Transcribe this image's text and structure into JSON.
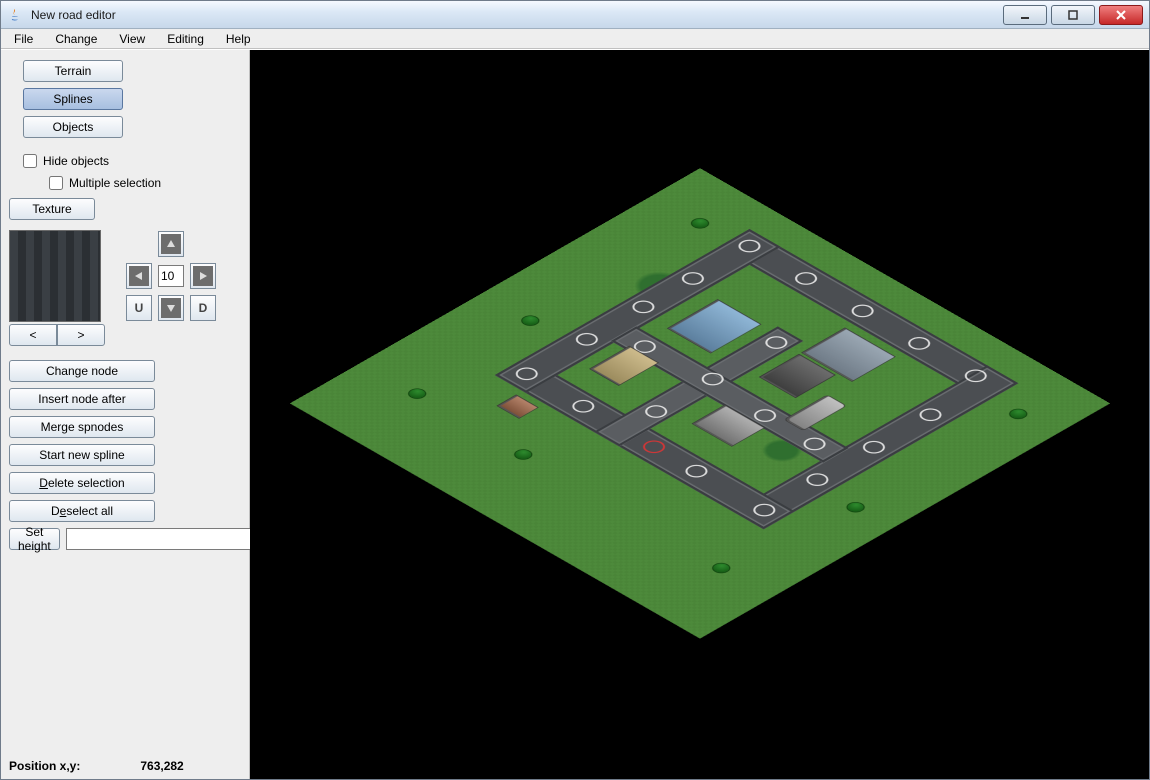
{
  "window": {
    "title": "New road editor"
  },
  "menu": {
    "file": "File",
    "change": "Change",
    "view": "View",
    "editing": "Editing",
    "help": "Help"
  },
  "sidebar": {
    "mode_buttons": {
      "terrain": "Terrain",
      "splines": "Splines",
      "objects": "Objects"
    },
    "hide_objects_label": "Hide objects",
    "hide_objects_checked": false,
    "multiple_selection_label": "Multiple selection",
    "multiple_selection_checked": false,
    "texture_button": "Texture",
    "texture_prev": "<",
    "texture_next": ">",
    "dpad_value": "10",
    "dpad_u_label": "U",
    "dpad_d_label": "D",
    "actions": {
      "change_node": "Change node",
      "insert_after": "Insert node after",
      "merge_spnodes": "Merge spnodes",
      "start_new_spline": "Start new spline",
      "delete_selection_pre": "D",
      "delete_selection_rest": "elete selection",
      "deselect_pre": "D",
      "deselect_mid": "e",
      "deselect_rest": "select all",
      "set_height": "Set height",
      "set_height_value": ""
    }
  },
  "status": {
    "label": "Position x,y:",
    "value": "763,282"
  }
}
